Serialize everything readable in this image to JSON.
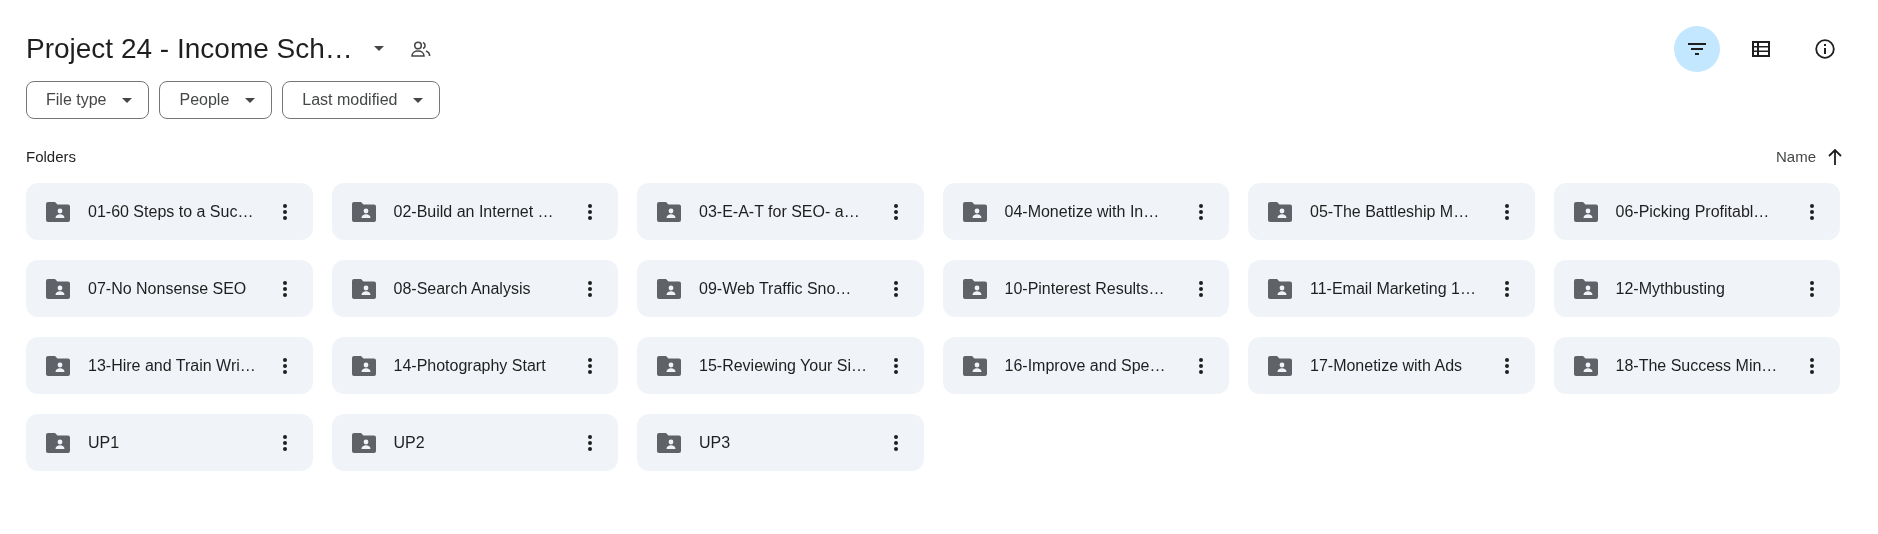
{
  "header": {
    "title": "Project 24 - Income Sch…"
  },
  "toolbar": [
    {
      "kind": "filter",
      "selected": true
    },
    {
      "kind": "list",
      "selected": false
    },
    {
      "kind": "info",
      "selected": false
    }
  ],
  "filters": [
    {
      "label": "File type"
    },
    {
      "label": "People"
    },
    {
      "label": "Last modified"
    }
  ],
  "section": {
    "title": "Folders",
    "sort_label": "Name"
  },
  "folders": [
    {
      "name": "01-60 Steps to a Suc…"
    },
    {
      "name": "02-Build an Internet …"
    },
    {
      "name": "03-E-A-T for SEO- a…"
    },
    {
      "name": "04-Monetize with In…"
    },
    {
      "name": "05-The Battleship M…"
    },
    {
      "name": "06-Picking Profitabl…"
    },
    {
      "name": "07-No Nonsense SEO"
    },
    {
      "name": "08-Search Analysis"
    },
    {
      "name": "09-Web Traffic Sno…"
    },
    {
      "name": "10-Pinterest Results…"
    },
    {
      "name": "11-Email Marketing 1…"
    },
    {
      "name": "12-Mythbusting"
    },
    {
      "name": "13-Hire and Train Wri…"
    },
    {
      "name": "14-Photography Start"
    },
    {
      "name": "15-Reviewing Your Si…"
    },
    {
      "name": "16-Improve and Spe…"
    },
    {
      "name": "17-Monetize with Ads"
    },
    {
      "name": "18-The Success Min…"
    },
    {
      "name": "UP1"
    },
    {
      "name": "UP2"
    },
    {
      "name": "UP3"
    }
  ]
}
